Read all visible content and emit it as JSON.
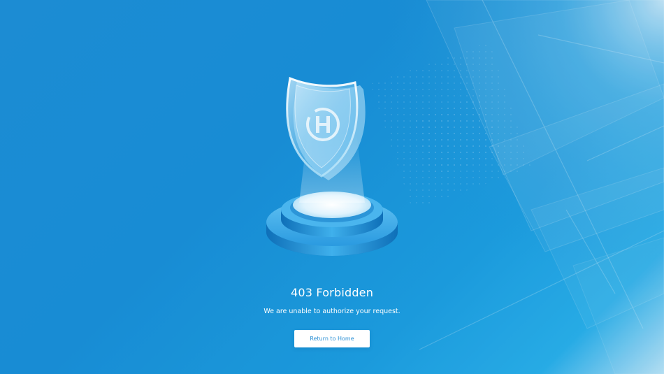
{
  "error": {
    "title": "403 Forbidden",
    "message": "We are unable to authorize your request.",
    "button_label": "Return to Home"
  },
  "illustration": {
    "icon": "shield-icon",
    "emblem": "h-logo-icon",
    "base": "pedestal"
  },
  "colors": {
    "background": "#1a8fd7",
    "background_highlight": "#bfe6f8",
    "button_background": "#ffffff",
    "button_text": "#2a8fd4",
    "text": "#ffffff"
  }
}
